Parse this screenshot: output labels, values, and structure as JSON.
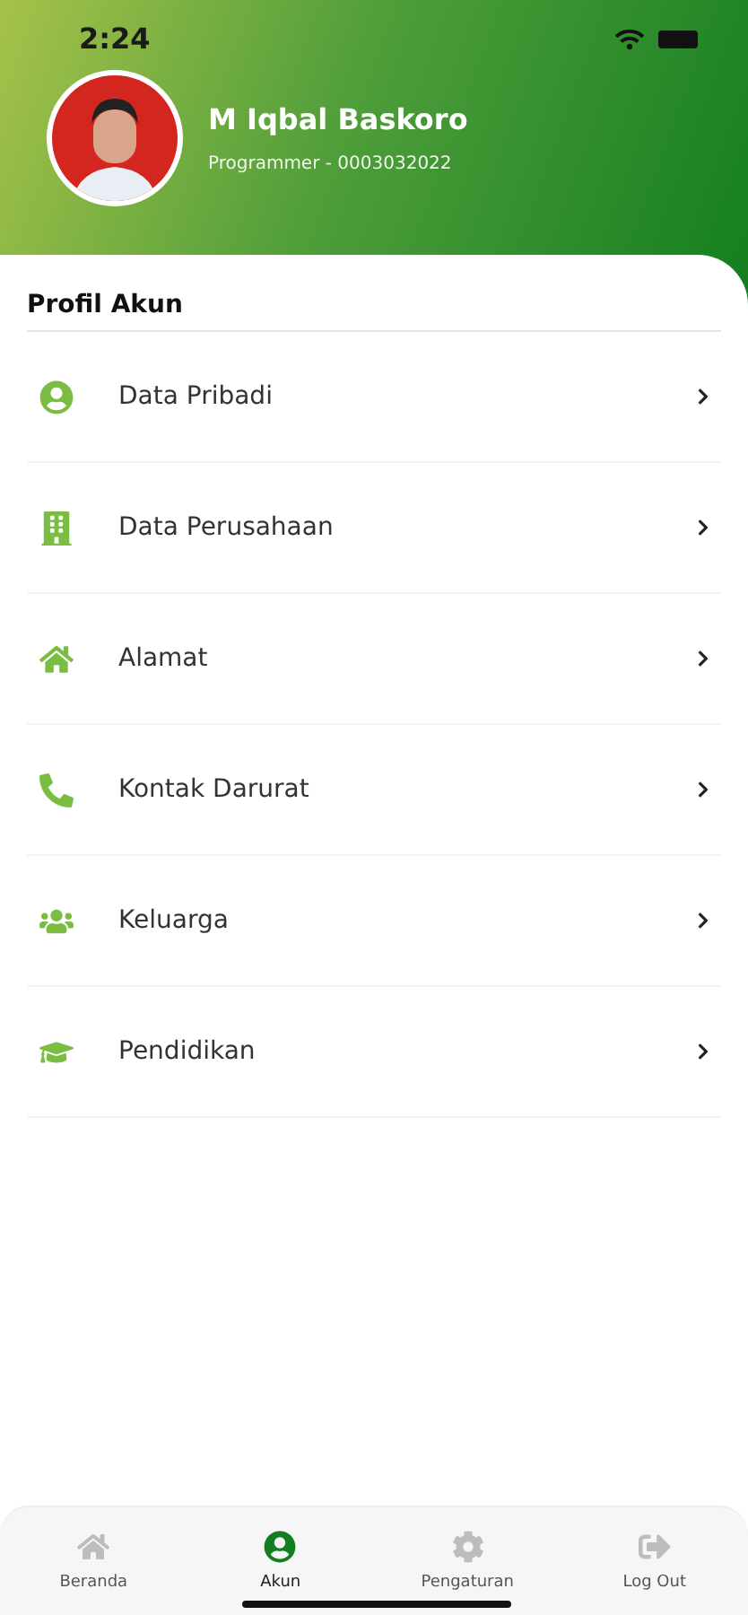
{
  "status_bar": {
    "time": "2:24"
  },
  "profile": {
    "name": "M Iqbal Baskoro",
    "subtitle": "Programmer - 0003032022"
  },
  "section_title": "Profil Akun",
  "menu": [
    {
      "kind": "person",
      "label": "Data Pribadi"
    },
    {
      "kind": "building",
      "label": "Data Perusahaan"
    },
    {
      "kind": "home",
      "label": "Alamat"
    },
    {
      "kind": "phone",
      "label": "Kontak Darurat"
    },
    {
      "kind": "family",
      "label": "Keluarga"
    },
    {
      "kind": "education",
      "label": "Pendidikan"
    }
  ],
  "bottom_nav": [
    {
      "kind": "home",
      "label": "Beranda",
      "selected": false
    },
    {
      "kind": "person",
      "label": "Akun",
      "selected": true
    },
    {
      "kind": "settings",
      "label": "Pengaturan",
      "selected": false
    },
    {
      "kind": "logout",
      "label": "Log Out",
      "selected": false
    }
  ]
}
